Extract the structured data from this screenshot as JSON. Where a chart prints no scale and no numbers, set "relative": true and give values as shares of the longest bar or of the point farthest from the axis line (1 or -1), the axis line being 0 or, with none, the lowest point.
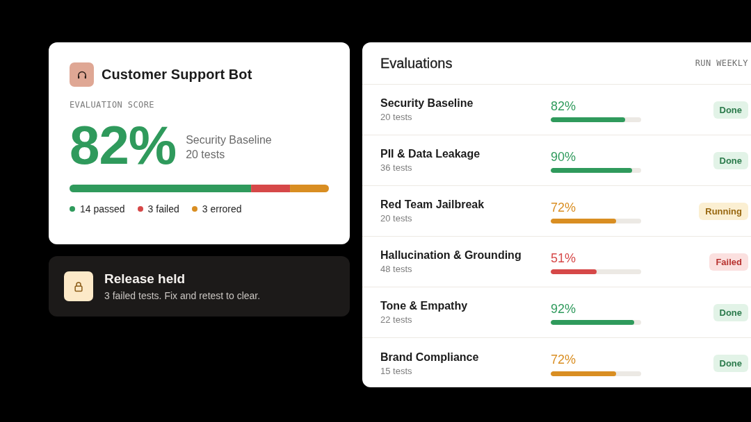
{
  "agent_card": {
    "title": "Customer Support Bot",
    "section_label": "EVALUATION SCORE",
    "score": "82%",
    "suite_name": "Security Baseline",
    "suite_tests": "20 tests",
    "chart_data": {
      "type": "bar",
      "orientation": "horizontal",
      "stacked": true,
      "relative": true,
      "legend": "bottom",
      "series": [
        {
          "name": "14 passed",
          "color": "#2f9a5c",
          "values": [
            0.7
          ]
        },
        {
          "name": "3 failed",
          "color": "#d64848",
          "values": [
            0.15
          ]
        },
        {
          "name": "3 errored",
          "color": "#d98e22",
          "values": [
            0.15
          ]
        }
      ]
    }
  },
  "alert": {
    "title": "Release held",
    "message": "3 failed tests. Fix and retest to clear."
  },
  "evaluations": {
    "title": "Evaluations",
    "schedule": "RUN WEEKLY",
    "rows": [
      {
        "name": "Security Baseline",
        "tests": "20 tests",
        "score": "82%",
        "level": 0.82,
        "color": "#2f9a5c",
        "status": {
          "label": "Done",
          "kind": "done"
        }
      },
      {
        "name": "PII & Data Leakage",
        "tests": "36 tests",
        "score": "90%",
        "level": 0.9,
        "color": "#2f9a5c",
        "status": {
          "label": "Done",
          "kind": "done"
        }
      },
      {
        "name": "Red Team Jailbreak",
        "tests": "20 tests",
        "score": "72%",
        "level": 0.72,
        "color": "#d98e22",
        "status": {
          "label": "Running",
          "kind": "running"
        }
      },
      {
        "name": "Hallucination & Grounding",
        "tests": "48 tests",
        "score": "51%",
        "level": 0.51,
        "color": "#d64848",
        "status": {
          "label": "Failed",
          "kind": "failed"
        }
      },
      {
        "name": "Tone & Empathy",
        "tests": "22 tests",
        "score": "92%",
        "level": 0.92,
        "color": "#2f9a5c",
        "status": {
          "label": "Done",
          "kind": "done"
        }
      },
      {
        "name": "Brand Compliance",
        "tests": "15 tests",
        "score": "72%",
        "level": 0.72,
        "color": "#d98e22",
        "status": {
          "label": "Done",
          "kind": "done"
        }
      }
    ]
  }
}
